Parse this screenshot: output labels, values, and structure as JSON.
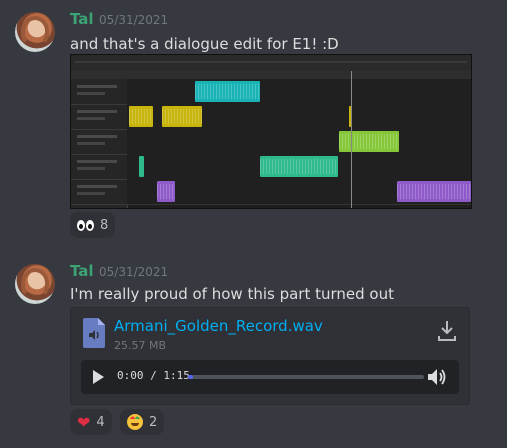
{
  "messages": [
    {
      "author": "Tal",
      "timestamp": "05/31/2021",
      "text": "and that's a dialogue edit for E1! :D",
      "reactions": [
        {
          "emoji": "eyes",
          "count": "8"
        }
      ]
    },
    {
      "author": "Tal",
      "timestamp": "05/31/2021",
      "text": "I'm really proud of how this part turned out",
      "attachment": {
        "filename": "Armani_Golden_Record.wav",
        "size": "25.57 MB",
        "current_time": "0:00",
        "separator": "/",
        "duration": "1:15",
        "progress": 0.01
      },
      "reactions": [
        {
          "emoji": "heart",
          "count": "4"
        },
        {
          "emoji": "rainbow-face",
          "count": "2"
        }
      ]
    }
  ],
  "colors": {
    "author": "#3ca374",
    "link": "#00aff4",
    "accent": "#5865f2",
    "clip_colors": [
      "#19b3b5",
      "#c7b40c",
      "#86c73a",
      "#2fba8e",
      "#8e5bc8"
    ]
  }
}
